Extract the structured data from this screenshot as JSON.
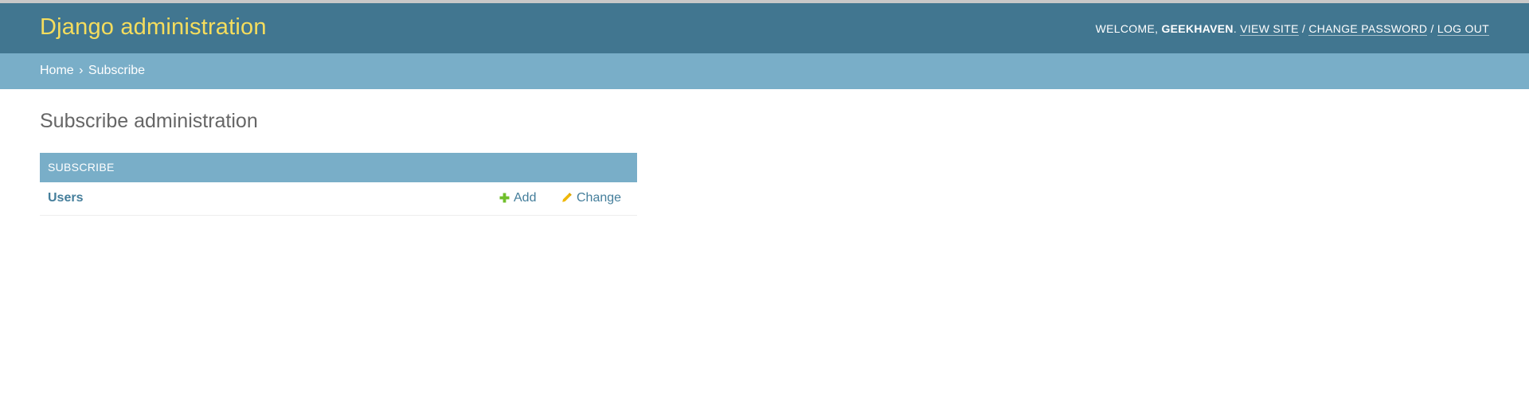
{
  "header": {
    "site_name": "Django administration",
    "welcome_label": "WELCOME,",
    "username": "GEEKHAVEN",
    "username_suffix": ".",
    "view_site": "VIEW SITE",
    "change_password": "CHANGE PASSWORD",
    "log_out": "LOG OUT",
    "separator": "/"
  },
  "breadcrumbs": {
    "home": "Home",
    "separator": "›",
    "current": "Subscribe"
  },
  "main": {
    "title": "Subscribe administration",
    "module": {
      "caption": "SUBSCRIBE",
      "rows": [
        {
          "model": "Users",
          "add_label": "Add",
          "change_label": "Change"
        }
      ]
    }
  },
  "colors": {
    "header_bg": "#417690",
    "site_name": "#f5dd5d",
    "breadcrumbs_bg": "#79aec8",
    "module_caption_bg": "#79aec8",
    "link": "#447e9b",
    "add_icon": "#70bf2b",
    "change_icon": "#efb80b"
  },
  "icons": {
    "add": "plus-icon",
    "change": "pencil-icon"
  }
}
